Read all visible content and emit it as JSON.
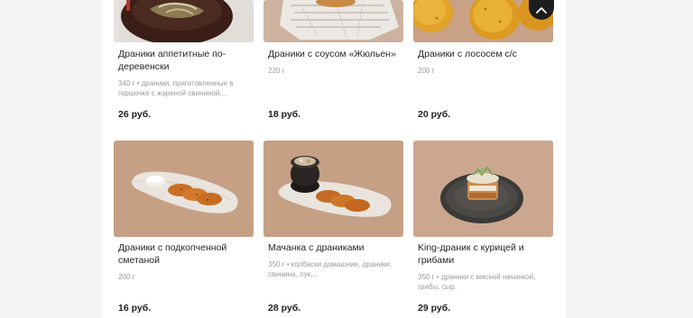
{
  "colors": {
    "page_background": "#f3f3f3",
    "content_background": "#ffffff",
    "photo_warm": "#c49a7e",
    "scroll_button": "#1d1d1d"
  },
  "scroll_top_button": {
    "icon": "chevron-up-icon"
  },
  "products": [
    {
      "title": "Драники аппетитные по-деревенски",
      "desc": "340 г • драники, приготовленные в горшочке с жареной свининой,...",
      "price": "26 руб."
    },
    {
      "title": "Драники с соусом «Жюльен»",
      "desc": "220 г",
      "price": "18 руб."
    },
    {
      "title": "Драники с лососем с/с",
      "desc": "200 г",
      "price": "20 руб."
    },
    {
      "title": "Драники с подкопченной сметаной",
      "desc": "200 г",
      "price": "16 руб."
    },
    {
      "title": "Мачанка с драниками",
      "desc": "350 г • колбаски домашние, драники, свинина, лук,...",
      "price": "28 руб."
    },
    {
      "title": "King-драник с курицей и грибами",
      "desc": "350 г • драники с мясной начинкой, грибы, сыр.",
      "price": "29 руб."
    }
  ]
}
